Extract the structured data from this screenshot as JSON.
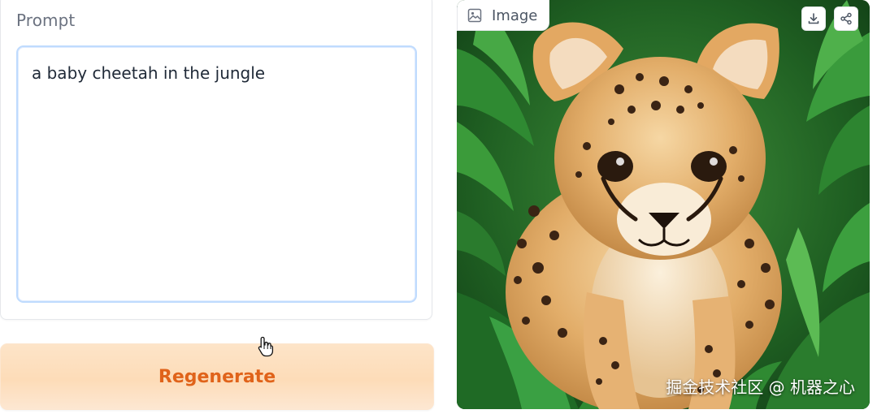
{
  "prompt": {
    "label": "Prompt",
    "value": "a baby cheetah in the jungle"
  },
  "actions": {
    "regenerate_label": "Regenerate"
  },
  "image_output": {
    "tag_label": "Image",
    "tag_icon": "image-icon",
    "download_icon": "download-icon",
    "share_icon": "share-icon",
    "watermark": "掘金技术社区 @ 机器之心"
  },
  "colors": {
    "accent_orange": "#e0631a",
    "button_bg": "#fddcb8",
    "textarea_focus": "#bfdbfe"
  }
}
